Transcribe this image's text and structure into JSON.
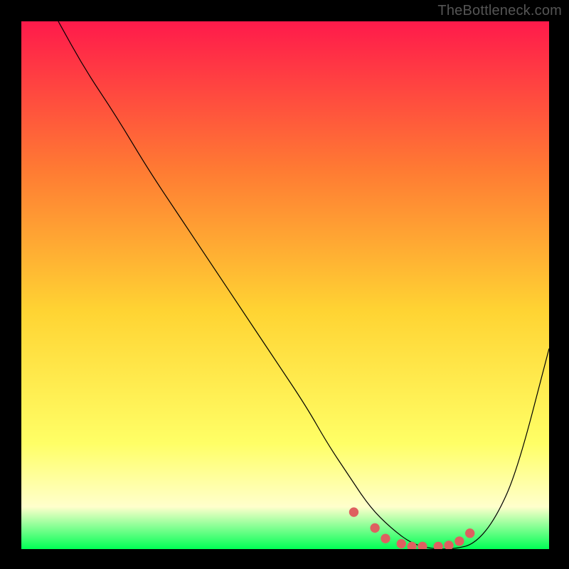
{
  "watermark": "TheBottleneck.com",
  "colors": {
    "frame_bg": "#000000",
    "gradient_top": "#ff1a4b",
    "gradient_mid_upper": "#ff7a33",
    "gradient_mid": "#ffd433",
    "gradient_low": "#ffff66",
    "gradient_pale": "#ffffcc",
    "gradient_bottom": "#00ff55",
    "curve_stroke": "#000000",
    "marker_stroke": "#de6060"
  },
  "chart_data": {
    "type": "line",
    "title": "",
    "xlabel": "",
    "ylabel": "",
    "xlim": [
      0,
      100
    ],
    "ylim": [
      0,
      100
    ],
    "series": [
      {
        "name": "bottleneck-curve",
        "x": [
          7,
          12,
          18,
          24,
          30,
          36,
          42,
          48,
          54,
          58,
          62,
          66,
          70,
          74,
          78,
          82,
          86,
          90,
          94,
          100
        ],
        "y": [
          100,
          91,
          82,
          72,
          63,
          54,
          45,
          36,
          27,
          20,
          14,
          8,
          4,
          1,
          0,
          0,
          1,
          6,
          15,
          38
        ]
      }
    ],
    "markers": {
      "name": "highlight-dots",
      "x": [
        63,
        67,
        69,
        72,
        74,
        76,
        79,
        81,
        83,
        85
      ],
      "y": [
        7,
        4,
        2,
        1,
        0.5,
        0.5,
        0.5,
        0.7,
        1.5,
        3
      ]
    }
  }
}
